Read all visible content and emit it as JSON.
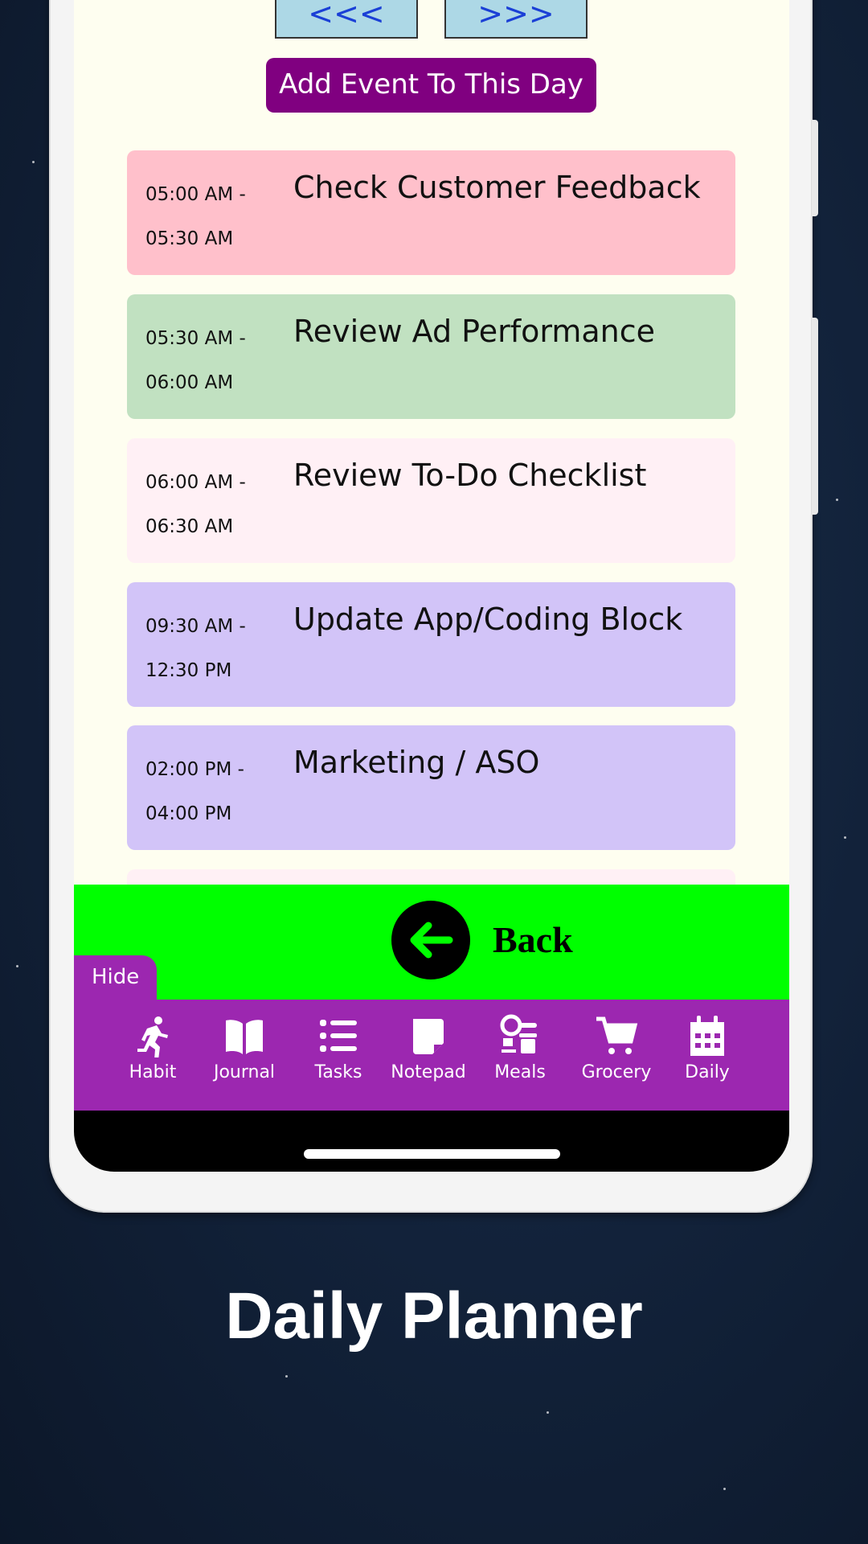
{
  "nav": {
    "prev_label": "<<<",
    "next_label": ">>>"
  },
  "add_event_label": "Add Event To This Day",
  "events": [
    {
      "start": "05:00 AM -",
      "end": "05:30 AM",
      "title": "Check Customer Feedback",
      "color": "#ffc0cb"
    },
    {
      "start": "05:30 AM -",
      "end": "06:00 AM",
      "title": "Review Ad Performance",
      "color": "#c1e1c1"
    },
    {
      "start": "06:00 AM -",
      "end": "06:30 AM",
      "title": "Review To-Do Checklist",
      "color": "#fff0f5"
    },
    {
      "start": "09:30 AM -",
      "end": "12:30 PM",
      "title": "Update App/Coding Block",
      "color": "#d2c4f8"
    },
    {
      "start": "02:00 PM -",
      "end": "04:00 PM",
      "title": "Marketing / ASO",
      "color": "#d2c4f8"
    }
  ],
  "back_label": "Back",
  "hide_label": "Hide",
  "bottom_nav": [
    {
      "label": "Habit",
      "icon": "running-icon"
    },
    {
      "label": "Journal",
      "icon": "book-icon"
    },
    {
      "label": "Tasks",
      "icon": "list-icon"
    },
    {
      "label": "Notepad",
      "icon": "note-icon"
    },
    {
      "label": "Meals",
      "icon": "meals-icon"
    },
    {
      "label": "Grocery",
      "icon": "cart-icon"
    },
    {
      "label": "Daily",
      "icon": "calendar-icon"
    }
  ],
  "caption": "Daily Planner",
  "colors": {
    "accent": "#800080",
    "nav_bg": "#9c27b0",
    "back_bar": "#00ff00",
    "screen_bg": "#fefef0"
  }
}
